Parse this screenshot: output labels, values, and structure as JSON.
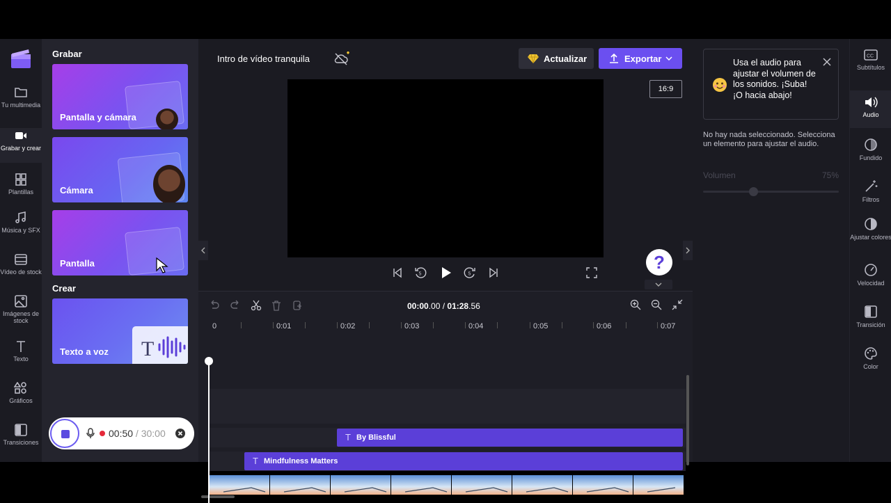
{
  "rail": [
    {
      "label": "Tu multimedia",
      "icon": "folder-icon"
    },
    {
      "label": "Grabar y crear",
      "icon": "video-camera-icon"
    },
    {
      "label": "Plantillas",
      "icon": "templates-icon"
    },
    {
      "label": "Música y SFX",
      "icon": "music-icon"
    },
    {
      "label": "Vídeo de stock",
      "icon": "film-icon"
    },
    {
      "label": "Imágenes de stock",
      "icon": "image-icon"
    },
    {
      "label": "Texto",
      "icon": "text-icon"
    },
    {
      "label": "Gráficos",
      "icon": "shapes-icon"
    },
    {
      "label": "Transiciones",
      "icon": "transitions-icon"
    }
  ],
  "panel": {
    "record_title": "Grabar",
    "cards": [
      "Pantalla y cámara",
      "Cámara",
      "Pantalla"
    ],
    "create_title": "Crear",
    "create_card": "Texto a voz",
    "recbar": {
      "elapsed": "00:50",
      "separator": " / ",
      "limit": "30:00"
    }
  },
  "header": {
    "project_title": "Intro de vídeo tranquila",
    "update_label": "Actualizar",
    "export_label": "Exportar"
  },
  "preview": {
    "aspect_ratio": "16:9",
    "help": "?"
  },
  "timeline": {
    "current": "00:00",
    "current_frac": ".00",
    "separator": " / ",
    "total": "01:28",
    "total_frac": ".56",
    "ruler": [
      "0",
      "0:01",
      "0:02",
      "0:03",
      "0:04",
      "0:05",
      "0:06",
      "0:07"
    ],
    "clips": [
      {
        "label": "By Blissful"
      },
      {
        "label": "Mindfulness Matters"
      }
    ]
  },
  "props": {
    "tip": "Usa el audio para ajustar el volumen de los sonidos. ¡Suba! ¡O hacia abajo!",
    "no_selection": "No hay nada seleccionado. Selecciona un elemento para ajustar el audio.",
    "volume_label": "Volumen",
    "volume_value": "75%",
    "volume_fraction": 0.75
  },
  "rrail": [
    {
      "label": "Subtítulos",
      "icon": "cc-icon"
    },
    {
      "label": "Audio",
      "icon": "speaker-icon"
    },
    {
      "label": "Fundido",
      "icon": "fade-icon"
    },
    {
      "label": "Filtros",
      "icon": "magic-wand-icon"
    },
    {
      "label": "Ajustar colores",
      "icon": "contrast-icon"
    },
    {
      "label": "Velocidad",
      "icon": "speedometer-icon"
    },
    {
      "label": "Transición",
      "icon": "transition-icon"
    },
    {
      "label": "Color",
      "icon": "palette-icon"
    }
  ],
  "colors": {
    "accent": "#6b4ff0",
    "clip": "#5b3fd8",
    "background": "#1b1b22"
  }
}
